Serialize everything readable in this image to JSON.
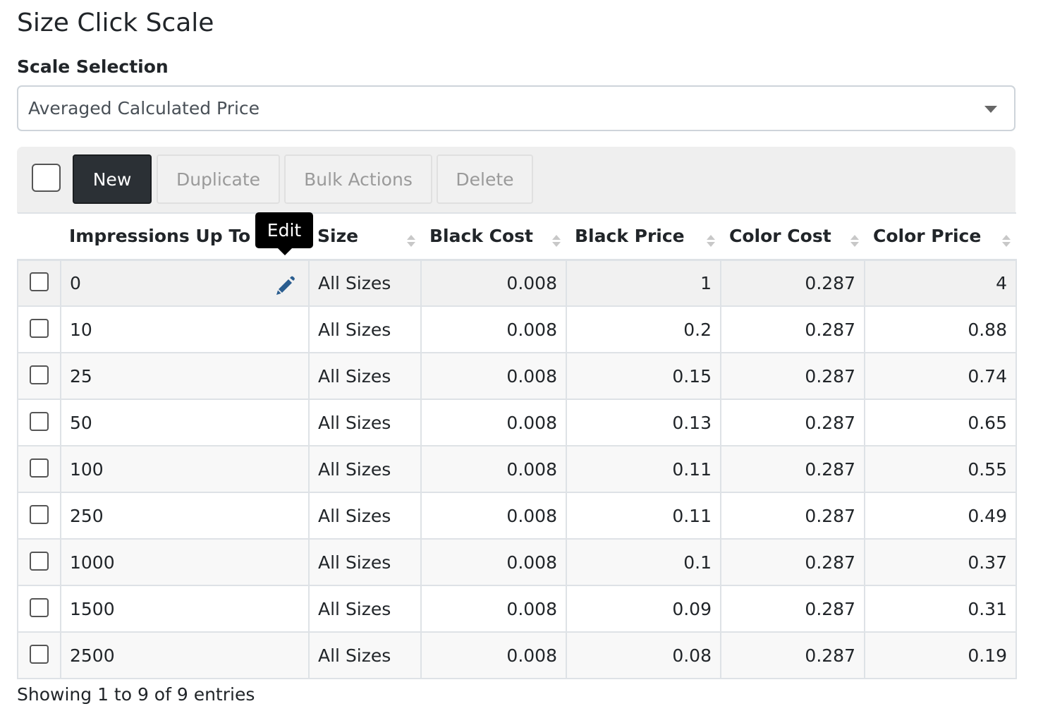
{
  "page": {
    "title": "Size Click Scale"
  },
  "scale_selection": {
    "label": "Scale Selection",
    "selected": "Averaged Calculated Price"
  },
  "toolbar": {
    "new_label": "New",
    "duplicate_label": "Duplicate",
    "bulk_label": "Bulk Actions",
    "delete_label": "Delete"
  },
  "tooltip": {
    "text": "Edit"
  },
  "table": {
    "columns": [
      "Impressions Up To",
      "Size",
      "Black Cost",
      "Black Price",
      "Color Cost",
      "Color Price"
    ],
    "rows": [
      [
        "0",
        "All Sizes",
        "0.008",
        "1",
        "0.287",
        "4"
      ],
      [
        "10",
        "All Sizes",
        "0.008",
        "0.2",
        "0.287",
        "0.88"
      ],
      [
        "25",
        "All Sizes",
        "0.008",
        "0.15",
        "0.287",
        "0.74"
      ],
      [
        "50",
        "All Sizes",
        "0.008",
        "0.13",
        "0.287",
        "0.65"
      ],
      [
        "100",
        "All Sizes",
        "0.008",
        "0.11",
        "0.287",
        "0.55"
      ],
      [
        "250",
        "All Sizes",
        "0.008",
        "0.11",
        "0.287",
        "0.49"
      ],
      [
        "1000",
        "All Sizes",
        "0.008",
        "0.1",
        "0.287",
        "0.37"
      ],
      [
        "1500",
        "All Sizes",
        "0.008",
        "0.09",
        "0.287",
        "0.31"
      ],
      [
        "2500",
        "All Sizes",
        "0.008",
        "0.08",
        "0.287",
        "0.19"
      ]
    ]
  },
  "footer": {
    "info": "Showing 1 to 9 of 9 entries"
  },
  "colors": {
    "primary_button": "#2b3035",
    "edit_icon": "#2a5d8f"
  },
  "icons": {
    "edit": "pencil-icon",
    "dropdown": "chevron-down-icon"
  }
}
